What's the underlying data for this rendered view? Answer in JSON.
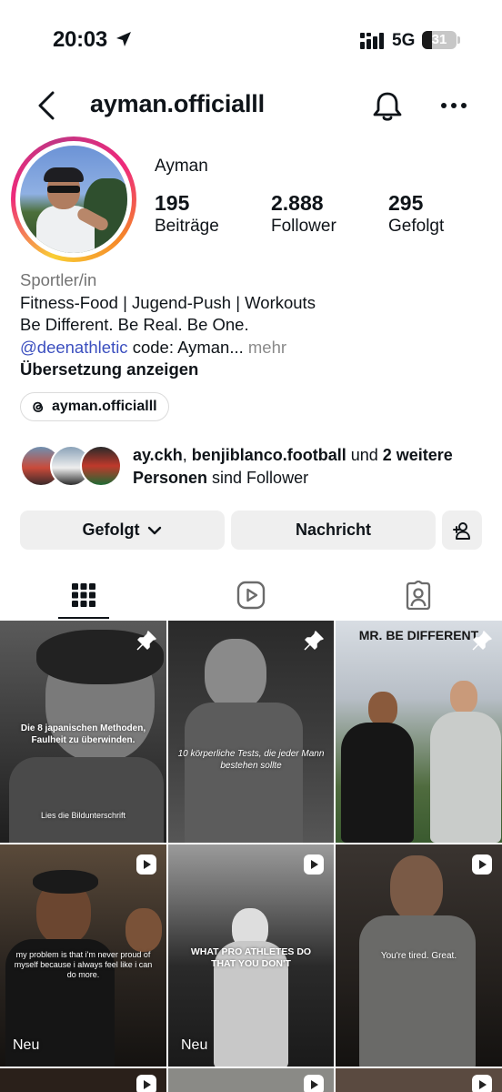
{
  "status_bar": {
    "time": "20:03",
    "network": "5G",
    "battery": "31"
  },
  "header": {
    "username": "ayman.officialll"
  },
  "profile": {
    "name": "Ayman",
    "stats": [
      {
        "value": "195",
        "label": "Beiträge"
      },
      {
        "value": "2.888",
        "label": "Follower"
      },
      {
        "value": "295",
        "label": "Gefolgt"
      }
    ],
    "category": "Sportler/in",
    "bio_line1": "Fitness-Food | Jugend-Push | Workouts",
    "bio_line2": "Be Different. Be Real. Be One.",
    "bio_mention": "@deenathletic",
    "bio_mention_rest": " code: Ayman...",
    "bio_more": " mehr",
    "translate": "Übersetzung anzeigen",
    "threads_handle": "ayman.officialll"
  },
  "followed_by": {
    "user1": "ay.ckh",
    "sep": ", ",
    "user2": "benjiblanco.football",
    "and": " und ",
    "others": "2 weitere Personen",
    "suffix": " sind Follower"
  },
  "actions": {
    "following": "Gefolgt",
    "message": "Nachricht"
  },
  "tabs": [
    {
      "icon": "grid-icon",
      "active": true
    },
    {
      "icon": "reels-icon",
      "active": false
    },
    {
      "icon": "tagged-icon",
      "active": false
    }
  ],
  "grid_posts": [
    {
      "caption": "Die 8 japanischen Methoden, Faulheit zu überwinden.",
      "footer": "Lies die Bildunterschrift",
      "badge": "pin-icon"
    },
    {
      "caption": "10 körperliche Tests, die jeder Mann bestehen sollte",
      "badge": "pin-icon"
    },
    {
      "caption": "MR. BE DIFFERENT",
      "badge": "pin-icon"
    },
    {
      "caption": "my problem is that i'm never proud of myself because i always feel like i can do more.",
      "label": "Neu",
      "badge": "reel-icon"
    },
    {
      "caption": "WHAT PRO ATHLETES DO THAT YOU DON'T",
      "label": "Neu",
      "badge": "reel-icon"
    },
    {
      "caption": "You're tired. Great.",
      "badge": "reel-icon"
    }
  ],
  "colors": {
    "accent_link": "#3b4fbf",
    "button_bg": "#efefef",
    "ring_gradient": [
      "#f9ce34",
      "#ee2a7b",
      "#c13584"
    ]
  }
}
